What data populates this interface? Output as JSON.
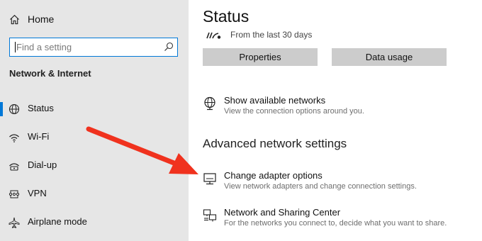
{
  "sidebar": {
    "home_label": "Home",
    "search_placeholder": "Find a setting",
    "section_title": "Network & Internet",
    "items": [
      {
        "label": "Status",
        "icon": "globe-icon",
        "selected": true
      },
      {
        "label": "Wi-Fi",
        "icon": "wifi-icon",
        "selected": false
      },
      {
        "label": "Dial-up",
        "icon": "dial-up-icon",
        "selected": false
      },
      {
        "label": "VPN",
        "icon": "vpn-icon",
        "selected": false
      },
      {
        "label": "Airplane mode",
        "icon": "airplane-icon",
        "selected": false
      }
    ]
  },
  "main": {
    "title": "Status",
    "usage_text": "From the last 30 days",
    "buttons": {
      "properties": "Properties",
      "data_usage": "Data usage"
    },
    "show_networks": {
      "title": "Show available networks",
      "desc": "View the connection options around you."
    },
    "advanced_title": "Advanced network settings",
    "adapter_options": {
      "title": "Change adapter options",
      "desc": "View network adapters and change connection settings."
    },
    "sharing_center": {
      "title": "Network and Sharing Center",
      "desc": "For the networks you connect to, decide what you want to share."
    }
  },
  "colors": {
    "accent": "#0078d7",
    "sidebar_bg": "#e6e6e6",
    "button_bg": "#cccccc",
    "annotation_arrow": "#f0321e"
  }
}
